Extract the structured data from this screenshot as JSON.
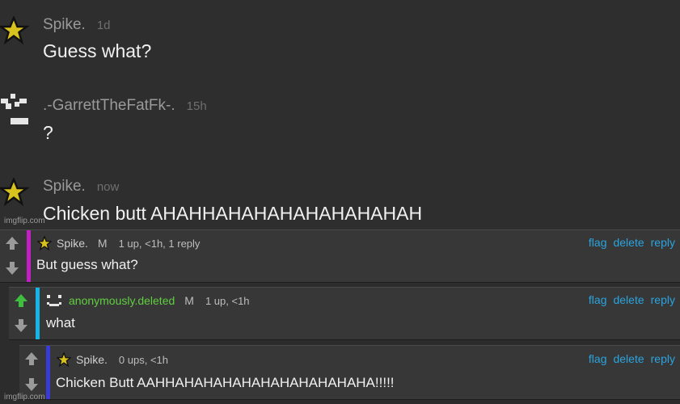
{
  "chat": {
    "messages": [
      {
        "username": "Spike.",
        "time": "1d",
        "text": "Guess what?",
        "avatar": "star-icon"
      },
      {
        "username": ".-GarrettTheFatFk-.",
        "time": "15h",
        "text": "?",
        "avatar": "pixel-face-icon"
      },
      {
        "username": "Spike.",
        "time": "now",
        "text": "Chicken butt AHAHHAHAHAHAHAHAHAHAH",
        "avatar": "star-icon"
      }
    ]
  },
  "watermark": "imgflip.com",
  "comments": [
    {
      "username": "Spike.",
      "mod": "M",
      "meta": "1 up, <1h, 1 reply",
      "text": "But guess what?",
      "accent": "#c41fc4",
      "upvoted": false
    },
    {
      "username": "anonymously.deleted",
      "mod": "M",
      "meta": "1 up, <1h",
      "text": "what",
      "accent": "#16b3e8",
      "upvoted": true
    },
    {
      "username": "Spike.",
      "mod": "",
      "meta": "0 ups, <1h",
      "text": "Chicken Butt AAHHAHAHAHAHAHAHAHAHAHAHA!!!!!",
      "accent": "#3a3ad8",
      "upvoted": false
    }
  ],
  "actions": {
    "flag": "flag",
    "delete": "delete",
    "reply": "reply"
  },
  "colors": {
    "link": "#2aa4df",
    "green_user": "#5fcf3f",
    "upvote_green": "#3fbf3f"
  }
}
